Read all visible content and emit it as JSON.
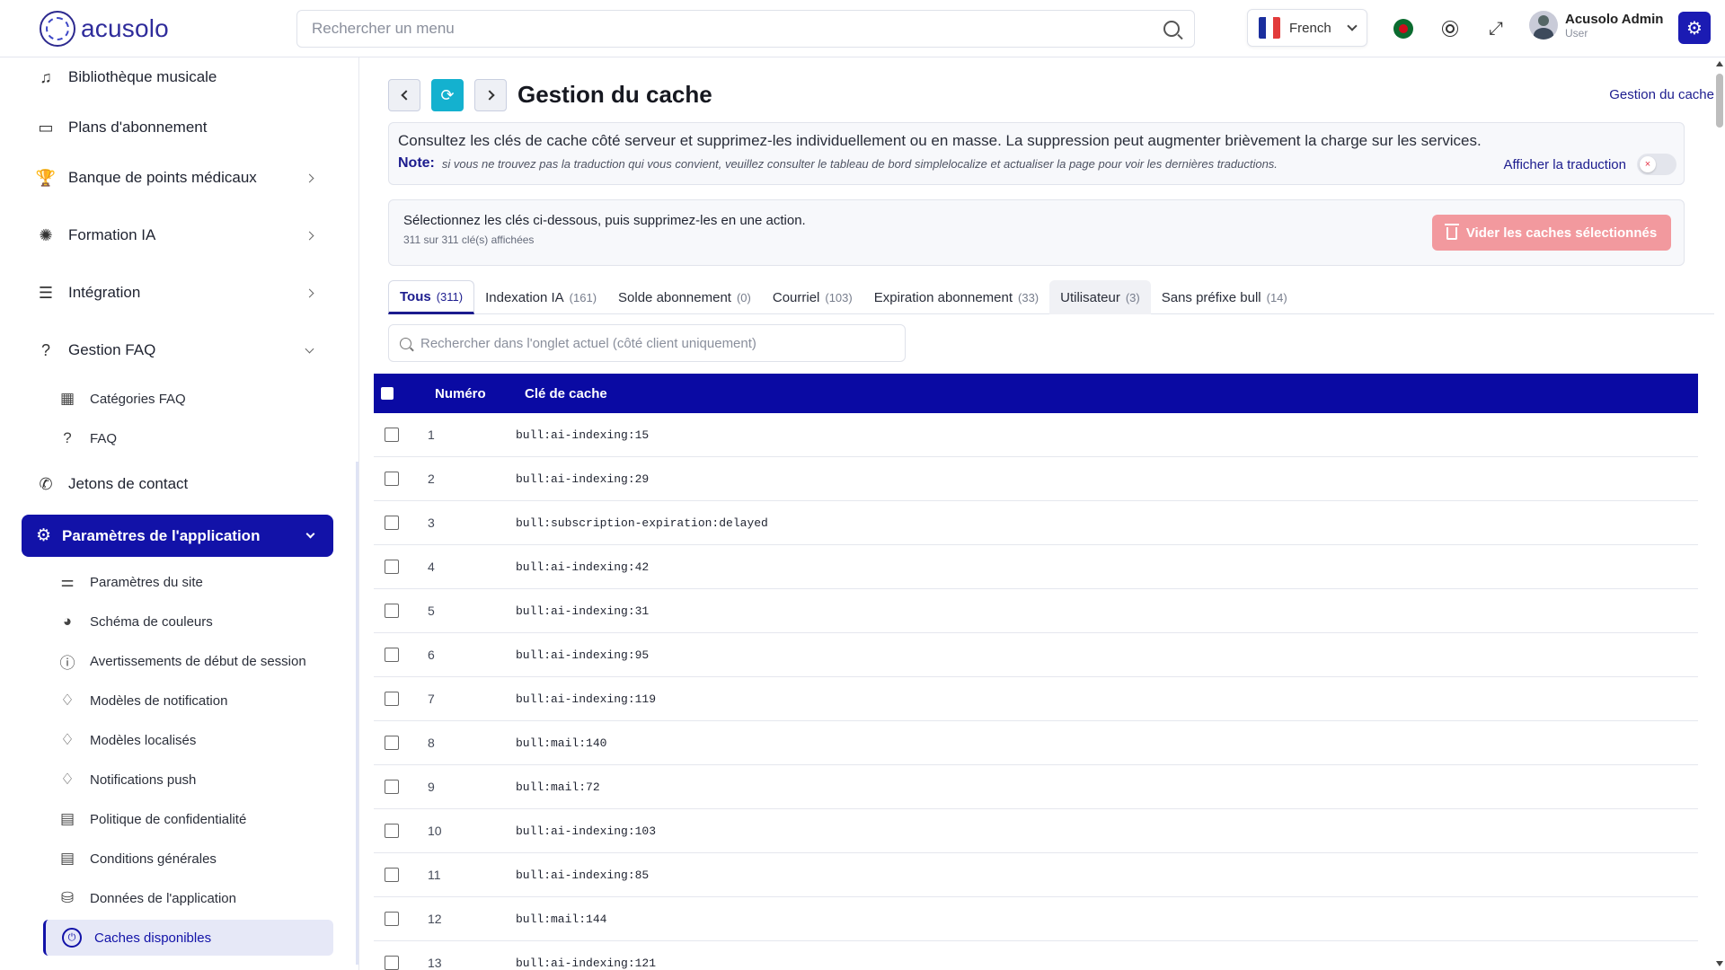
{
  "header": {
    "brand": "acusolo",
    "search_placeholder": "Rechercher un menu",
    "language": "French",
    "user_name": "Acusolo Admin",
    "user_role": "User",
    "accent": "#1212a8"
  },
  "sidebar": {
    "items": [
      {
        "label": "Bibliothèque musicale",
        "icon": "music-note-icon"
      },
      {
        "label": "Plans d'abonnement",
        "icon": "money-icon"
      },
      {
        "label": "Banque de points médicaux",
        "icon": "trophy-icon"
      },
      {
        "label": "Formation IA",
        "icon": "brain-icon"
      },
      {
        "label": "Intégration",
        "icon": "sliders-icon"
      },
      {
        "label": "Gestion FAQ",
        "icon": "help-circle-icon"
      }
    ],
    "faq_sub": [
      {
        "label": "Catégories FAQ",
        "icon": "category-icon"
      },
      {
        "label": "FAQ",
        "icon": "help-circle-icon"
      }
    ],
    "contact": {
      "label": "Jetons de contact",
      "icon": "phone-icon"
    },
    "active_group": {
      "label": "Paramètres de l'application",
      "icon": "gear-icon"
    },
    "settings_sub": [
      {
        "label": "Paramètres du site",
        "icon": "settings-sliders-icon"
      },
      {
        "label": "Schéma de couleurs",
        "icon": "palette-icon"
      },
      {
        "label": "Avertissements de début de session",
        "icon": "alert-bubble-icon"
      },
      {
        "label": "Modèles de notification",
        "icon": "bell-icon"
      },
      {
        "label": "Modèles localisés",
        "icon": "bell-globe-icon"
      },
      {
        "label": "Notifications push",
        "icon": "bell-ring-icon"
      },
      {
        "label": "Politique de confidentialité",
        "icon": "document-icon"
      },
      {
        "label": "Conditions générales",
        "icon": "document-icon"
      },
      {
        "label": "Données de l'application",
        "icon": "database-icon"
      }
    ],
    "selected": {
      "label": "Caches disponibles",
      "icon": "power-icon"
    }
  },
  "main": {
    "title": "Gestion du cache",
    "breadcrumb": "Gestion du cache",
    "notice_text": "Consultez les clés de cache côté serveur et supprimez-les individuellement ou en masse. La suppression peut augmenter brièvement la charge sur les services.",
    "note_label": "Note:",
    "note_text": "si vous ne trouvez pas la traduction qui vous convient, veuillez consulter le tableau de bord simplelocalize et actualiser la page pour voir les dernières traductions.",
    "toggle_label": "Afficher la traduction",
    "bulk_title": "Sélectionnez les clés ci-dessous, puis supprimez-les en une action.",
    "bulk_sub": "311 sur 311 clé(s) affichées",
    "bulk_button": "Vider les caches sélectionnés",
    "tabs": [
      {
        "label": "Tous",
        "count": "(311)"
      },
      {
        "label": "Indexation IA",
        "count": "(161)"
      },
      {
        "label": "Solde abonnement",
        "count": "(0)"
      },
      {
        "label": "Courriel",
        "count": "(103)"
      },
      {
        "label": "Expiration abonnement",
        "count": "(33)"
      },
      {
        "label": "Utilisateur",
        "count": "(3)"
      },
      {
        "label": "Sans préfixe bull",
        "count": "(14)"
      }
    ],
    "tab_search_placeholder": "Rechercher dans l'onglet actuel (côté client uniquement)",
    "table": {
      "columns": [
        "Numéro",
        "Clé de cache"
      ],
      "rows": [
        [
          "1",
          "bull:ai-indexing:15"
        ],
        [
          "2",
          "bull:ai-indexing:29"
        ],
        [
          "3",
          "bull:subscription-expiration:delayed"
        ],
        [
          "4",
          "bull:ai-indexing:42"
        ],
        [
          "5",
          "bull:ai-indexing:31"
        ],
        [
          "6",
          "bull:ai-indexing:95"
        ],
        [
          "7",
          "bull:ai-indexing:119"
        ],
        [
          "8",
          "bull:mail:140"
        ],
        [
          "9",
          "bull:mail:72"
        ],
        [
          "10",
          "bull:ai-indexing:103"
        ],
        [
          "11",
          "bull:ai-indexing:85"
        ],
        [
          "12",
          "bull:mail:144"
        ],
        [
          "13",
          "bull:ai-indexing:121"
        ]
      ]
    }
  }
}
